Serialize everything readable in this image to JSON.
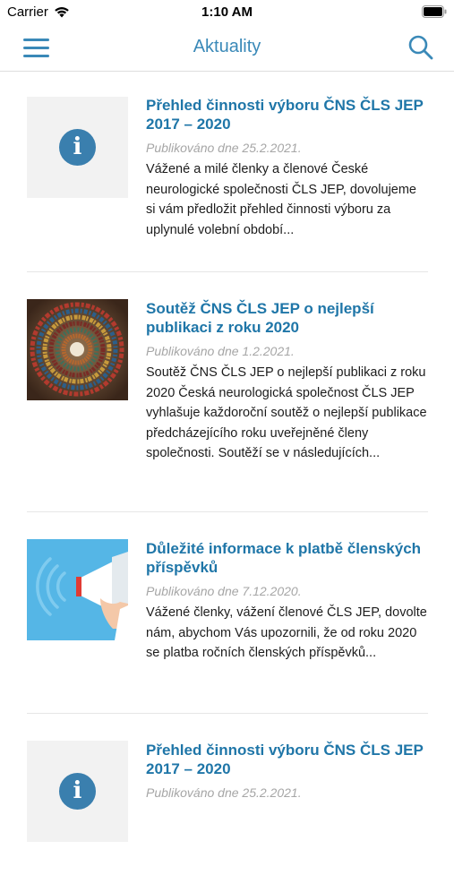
{
  "status_bar": {
    "carrier": "Carrier",
    "time": "1:10 AM"
  },
  "nav": {
    "title": "Aktuality",
    "menu_icon": "hamburger-menu-icon",
    "search_icon": "search-icon"
  },
  "colors": {
    "accent": "#3a89b8",
    "title": "#1f76a8",
    "date": "#a6a6a6"
  },
  "articles": [
    {
      "title": "Přehled činnosti výboru ČNS ČLS JEP 2017 – 2020",
      "date": "Publikováno dne 25.2.2021.",
      "excerpt": "Vážené a milé členky a členové České neurologické společnosti ČLS JEP, dovolujeme si vám předložit přehled činnosti výboru za uplynulé volební období...",
      "thumb": "info-icon"
    },
    {
      "title": "Soutěž ČNS ČLS JEP o nejlepší publikaci z roku 2020",
      "date": "Publikováno dne 1.2.2021.",
      "excerpt": "Soutěž ČNS ČLS JEP o nejlepší publikaci z roku 2020 Česká neurologická společnost ČLS JEP vyhlašuje každoroční soutěž o nejlepší publikace předcházejícího roku uveřejněné členy společnosti.  Soutěží se v následujících...",
      "thumb": "library-spiral-image"
    },
    {
      "title": "Důležité informace k platbě členských příspěvků",
      "date": "Publikováno dne 7.12.2020.",
      "excerpt": " Vážené členky, vážení členové ČLS JEP, dovolte nám, abychom Vás upozornili, že od roku 2020 se platba ročních členských příspěvků...",
      "thumb": "megaphone-image"
    },
    {
      "title": "Přehled činnosti výboru ČNS ČLS JEP 2017 – 2020",
      "date": "Publikováno dne 25.2.2021.",
      "excerpt": "",
      "thumb": "info-icon"
    }
  ]
}
